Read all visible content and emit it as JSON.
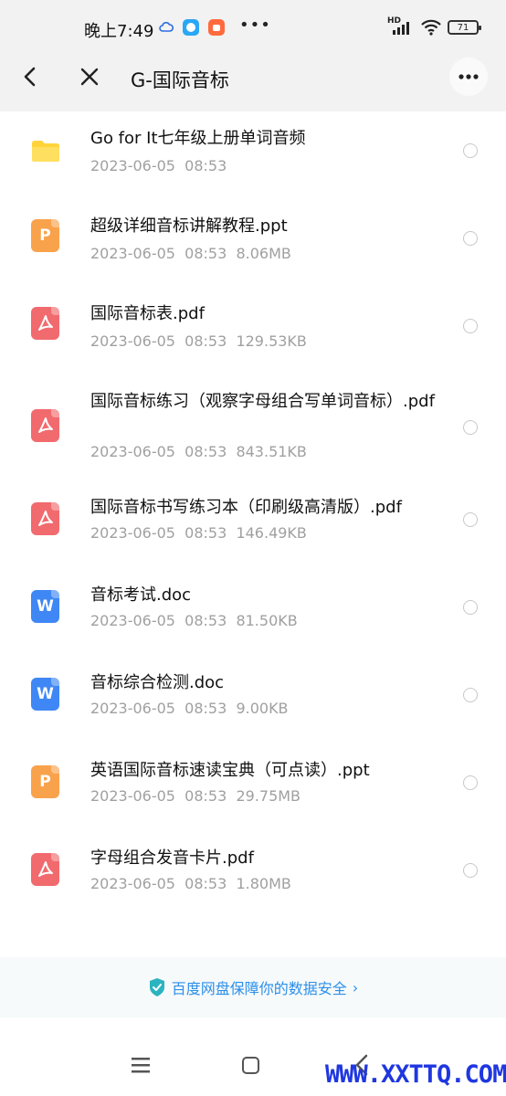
{
  "status_bar": {
    "time": "晚上7:49",
    "hd": "HD",
    "battery": "71"
  },
  "nav": {
    "title": "G-国际音标"
  },
  "files": [
    {
      "type": "folder",
      "name": "Go for It七年级上册单词音频",
      "meta": "2023-06-05  08:53",
      "icon": "folder-icon"
    },
    {
      "type": "ppt",
      "letter": "P",
      "name": "超级详细音标讲解教程.ppt",
      "meta": "2023-06-05  08:53  8.06MB",
      "icon": "ppt-file-icon"
    },
    {
      "type": "pdf",
      "name": "国际音标表.pdf",
      "meta": "2023-06-05  08:53  129.53KB",
      "icon": "pdf-file-icon"
    },
    {
      "type": "pdf",
      "name": "国际音标练习（观察字母组合写单词音标）.pdf",
      "meta": "2023-06-05  08:53  843.51KB",
      "icon": "pdf-file-icon"
    },
    {
      "type": "pdf",
      "name": "国际音标书写练习本（印刷级高清版）.pdf",
      "meta": "2023-06-05  08:53  146.49KB",
      "icon": "pdf-file-icon"
    },
    {
      "type": "doc",
      "letter": "W",
      "name": "音标考试.doc",
      "meta": "2023-06-05  08:53  81.50KB",
      "icon": "word-file-icon"
    },
    {
      "type": "doc",
      "letter": "W",
      "name": "音标综合检测.doc",
      "meta": "2023-06-05  08:53  9.00KB",
      "icon": "word-file-icon"
    },
    {
      "type": "ppt",
      "letter": "P",
      "name": "英语国际音标速读宝典（可点读）.ppt",
      "meta": "2023-06-05  08:53  29.75MB",
      "icon": "ppt-file-icon"
    },
    {
      "type": "pdf",
      "name": "字母组合发音卡片.pdf",
      "meta": "2023-06-05  08:53  1.80MB",
      "icon": "pdf-file-icon"
    }
  ],
  "footer": {
    "safety_text": "百度网盘保障你的数据安全",
    "safety_arrow": "›"
  },
  "watermark": "WWW.XXTTQ.COM",
  "colors": {
    "folder": "#ffd43b",
    "ppt": "#f9a24c",
    "pdf": "#f16a6e",
    "doc": "#3f87f5",
    "link": "#2d8fe8",
    "watermark": "#1f37e0"
  }
}
